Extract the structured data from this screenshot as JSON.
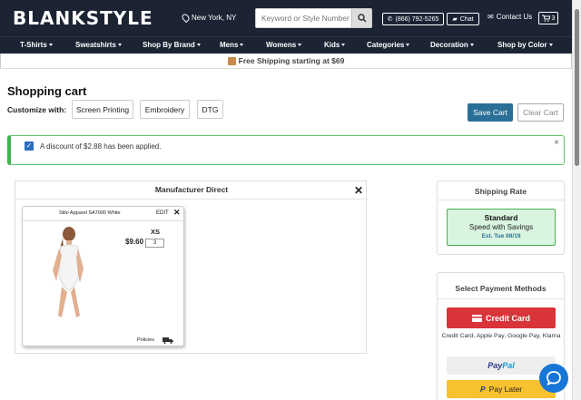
{
  "header": {
    "logo": "BLANKSTYLE",
    "location": "New York, NY",
    "search_placeholder": "Keyword or Style Number",
    "phone": "(866) 792-5265",
    "chat_label": "Chat",
    "contact_label": "Contact Us",
    "cart_count": "3"
  },
  "nav": {
    "items": [
      "T-Shirts",
      "Sweatshirts",
      "Shop By Brand",
      "Mens",
      "Womens",
      "Kids",
      "Categories",
      "Decoration",
      "Shop by Color"
    ]
  },
  "promo": {
    "text": "Free Shipping starting at $69"
  },
  "page": {
    "title": "Shopping cart",
    "customize_label": "Customize with:",
    "customize_options": [
      "Screen Printing",
      "Embroidery",
      "DTG"
    ],
    "save_cart": "Save Cart",
    "clear_cart": "Clear Cart"
  },
  "alert": {
    "text": "A discount of $2.88 has been applied."
  },
  "manufacturer": {
    "title": "Manufacturer Direct",
    "product": {
      "name": "Stilo Apparel SA7000 White",
      "edit_label": "EDIT",
      "price": "$9.60",
      "size": "XS",
      "quantity": "3",
      "policies_label": "Policies"
    }
  },
  "shipping": {
    "title": "Shipping Rate",
    "option": "Standard",
    "subtitle": "Speed with Savings",
    "estimate": "Est. Tue 08/19"
  },
  "payment": {
    "title": "Select Payment Methods",
    "credit_card": "Credit Card",
    "credit_note": "Credit Card, Apple Pay, Google Pay, Klarna",
    "paypal_pay": "Pay",
    "paypal_pal": "Pal",
    "pay_later": "Pay Later"
  },
  "colors": {
    "header_bg": "#1c2333",
    "save_btn": "#2a6f97",
    "success_green": "#3fb34f",
    "credit_red": "#d9343a",
    "paylater_yellow": "#f7c12f",
    "chat_blue": "#1877d6"
  }
}
